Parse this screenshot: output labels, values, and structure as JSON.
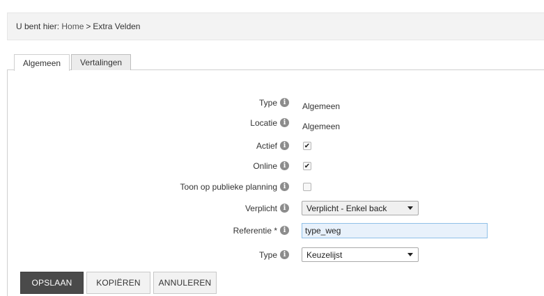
{
  "breadcrumb": {
    "prefix": "U bent hier:",
    "home": "Home",
    "separator": ">",
    "current": "Extra Velden"
  },
  "tabs": [
    {
      "label": "Algemeen",
      "active": true
    },
    {
      "label": "Vertalingen",
      "active": false
    }
  ],
  "form": {
    "type": {
      "label": "Type",
      "value": "Algemeen"
    },
    "locatie": {
      "label": "Locatie",
      "value": "Algemeen"
    },
    "actief": {
      "label": "Actief",
      "checked": true
    },
    "online": {
      "label": "Online",
      "checked": true
    },
    "publieke_planning": {
      "label": "Toon op publieke planning",
      "checked": false
    },
    "verplicht": {
      "label": "Verplicht",
      "selected": "Verplicht - Enkel back"
    },
    "referentie": {
      "label": "Referentie *",
      "value": "type_weg"
    },
    "type_select": {
      "label": "Type",
      "selected": "Keuzelijst"
    }
  },
  "info_icon_glyph": "i",
  "check_glyph": "✔",
  "buttons": {
    "save": "OPSLAAN",
    "copy": "KOPIËREN",
    "cancel": "ANNULEREN"
  },
  "colors": {
    "primary_button": "#4a4a4a",
    "input_focus_bg": "#e8f1fb",
    "input_focus_border": "#8fc0e8"
  }
}
